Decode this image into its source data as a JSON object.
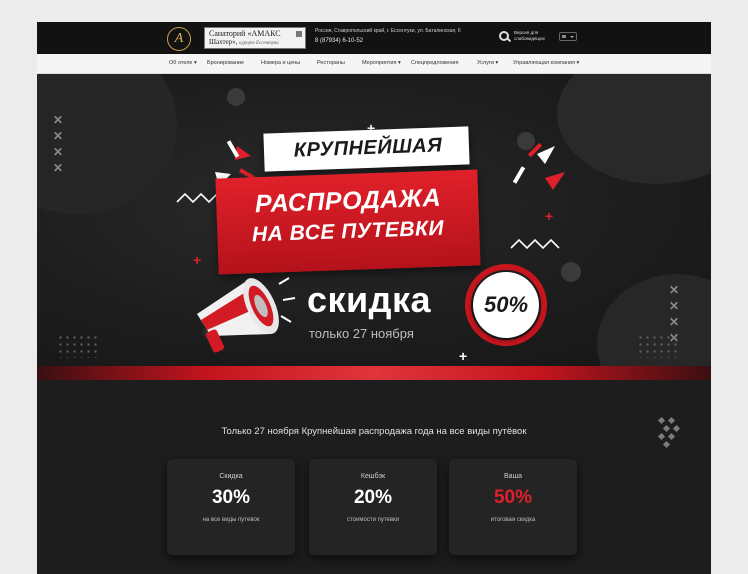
{
  "header": {
    "logo_letter": "А",
    "brand_line1": "Санаторий «АМАКС",
    "brand_line2": "Шахтер»,",
    "brand_line2_small": "курорт Ессентуки",
    "address": "Россия, Ставропольский край, г. Ессентуки, ул. Баталинская, 6",
    "phone": "8 (87934) 6-10-52",
    "accessibility_text": "Версия для слабовидящих"
  },
  "nav": {
    "items": [
      "Об отеле ▾",
      "Бронирование",
      "Номера и цены",
      "Рестораны",
      "Мероприятия ▾",
      "Спецпредложения",
      "Услуги ▾",
      "Управляющая компания ▾"
    ]
  },
  "hero": {
    "tag_text": "КРУПНЕЙШАЯ",
    "banner_line1": "РАСПРОДАЖА",
    "banner_line2": "НА ВСЕ ПУТЕВКИ",
    "discount_word": "скидка",
    "discount_value": "50%",
    "date_text": "только 27 ноября",
    "colors": {
      "accent_red": "#e0202a",
      "background": "#1d1d1d"
    },
    "icon": "megaphone-icon"
  },
  "promo": {
    "headline": "Только 27 ноября Крупнейшая распродажа года на все виды путёвок",
    "cards": [
      {
        "label": "Скидка",
        "value": "30%",
        "sub": "на все виды путевок"
      },
      {
        "label": "Кешбэк",
        "value": "20%",
        "sub": "стоимости путевки"
      },
      {
        "label": "Ваша",
        "value": "50%",
        "sub": "итоговая скидка"
      }
    ]
  }
}
